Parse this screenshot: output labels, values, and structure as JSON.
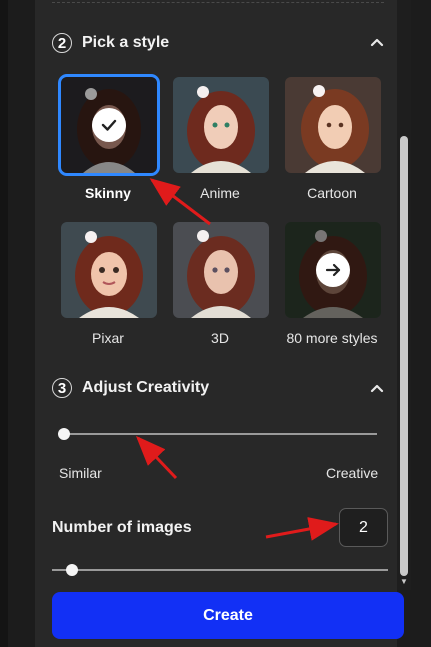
{
  "sections": {
    "style": {
      "number": "2",
      "title": "Pick a style"
    },
    "creativity": {
      "number": "3",
      "title": "Adjust Creativity"
    }
  },
  "styles": [
    {
      "label": "Skinny",
      "selected": true
    },
    {
      "label": "Anime",
      "selected": false
    },
    {
      "label": "Cartoon",
      "selected": false
    },
    {
      "label": "Pixar",
      "selected": false
    },
    {
      "label": "3D",
      "selected": false
    },
    {
      "label": "80 more styles",
      "selected": false
    }
  ],
  "creativity": {
    "min_label": "Similar",
    "max_label": "Creative",
    "value_fraction": 0.0
  },
  "images": {
    "label": "Number of images",
    "value": "2",
    "slider_fraction": 0.06
  },
  "actions": {
    "create_label": "Create"
  },
  "colors": {
    "primary": "#1230f5",
    "selected_outline": "#2f88ff",
    "annotation_arrow": "#e01b1b"
  }
}
